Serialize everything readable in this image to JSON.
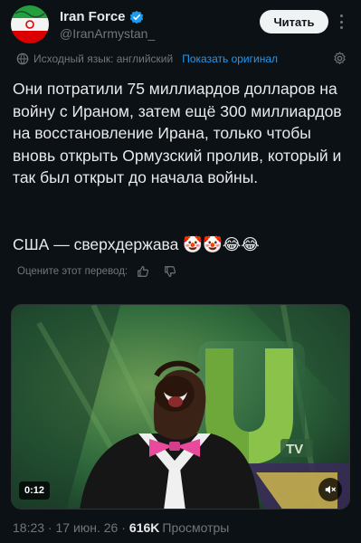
{
  "author": {
    "display_name": "Iran Force",
    "handle": "@IranArmystan_",
    "verified": true
  },
  "follow_button_label": "Читать",
  "translation": {
    "source_language": "Исходный язык: английский",
    "show_original_label": "Показать оригинал"
  },
  "tweet": {
    "text": "Они потратили 75 миллиардов долларов на войну с Ираном, затем ещё 300 миллиардов на восстановление Ирана, только чтобы вновь открыть Ормузский пролив, который и так был открыт до начала войны.",
    "text2": "США — сверхдержава 🤡🤡😂😂"
  },
  "rate_translation_label": "Оцените этот перевод:",
  "media": {
    "duration": "0:12",
    "logo_text": "TV"
  },
  "meta": {
    "timestamp": "18:23 · 17 июн. 26 ·",
    "views_count": "616K",
    "views_label": "Просмотры"
  },
  "colors": {
    "background": "#0c1116",
    "accent": "#1d9bf0",
    "secondary_text": "#71767b"
  },
  "icons": [
    "verified-badge-icon",
    "globe-icon",
    "gear-icon",
    "thumbs-up-icon",
    "thumbs-down-icon",
    "volume-muted-icon",
    "more-icon"
  ]
}
